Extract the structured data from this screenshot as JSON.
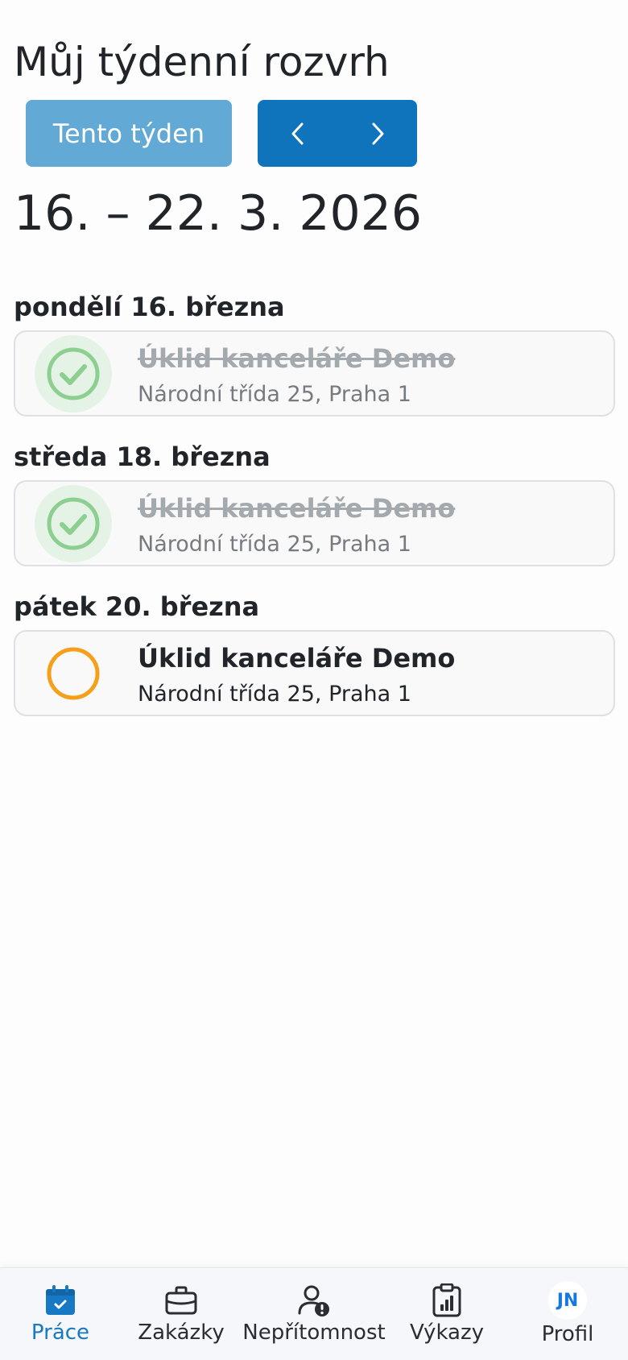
{
  "page": {
    "title": "Můj týdenní rozvrh",
    "this_week_label": "Tento týden",
    "week_range": "16. – 22. 3. 2026"
  },
  "colors": {
    "primary": "#0f74bc",
    "this_week_button": "#63a9d5",
    "done_check": "#8dcf90",
    "pending_ring": "#f5a01a",
    "active_nav": "#1779c4"
  },
  "days": [
    {
      "heading": "pondělí 16. března",
      "jobs": [
        {
          "title": "Úklid kanceláře Demo",
          "address": "Národní třída 25, Praha 1",
          "status": "completed",
          "icon": "check-circle-icon"
        }
      ]
    },
    {
      "heading": "středa 18. března",
      "jobs": [
        {
          "title": "Úklid kanceláře Demo",
          "address": "Národní třída 25, Praha 1",
          "status": "completed",
          "icon": "check-circle-icon"
        }
      ]
    },
    {
      "heading": "pátek 20. března",
      "jobs": [
        {
          "title": "Úklid kanceláře Demo",
          "address": "Národní třída 25, Praha 1",
          "status": "pending",
          "icon": "empty-circle-icon"
        }
      ]
    }
  ],
  "bottom_nav": {
    "items": [
      {
        "label": "Práce",
        "icon": "calendar-check-icon",
        "active": true
      },
      {
        "label": "Zakázky",
        "icon": "briefcase-icon",
        "active": false
      },
      {
        "label": "Nepřítomnost",
        "icon": "person-alert-icon",
        "active": false
      },
      {
        "label": "Výkazy",
        "icon": "clipboard-chart-icon",
        "active": false
      },
      {
        "label": "Profil",
        "icon": "avatar",
        "avatar_initials": "JN",
        "active": false
      }
    ]
  }
}
